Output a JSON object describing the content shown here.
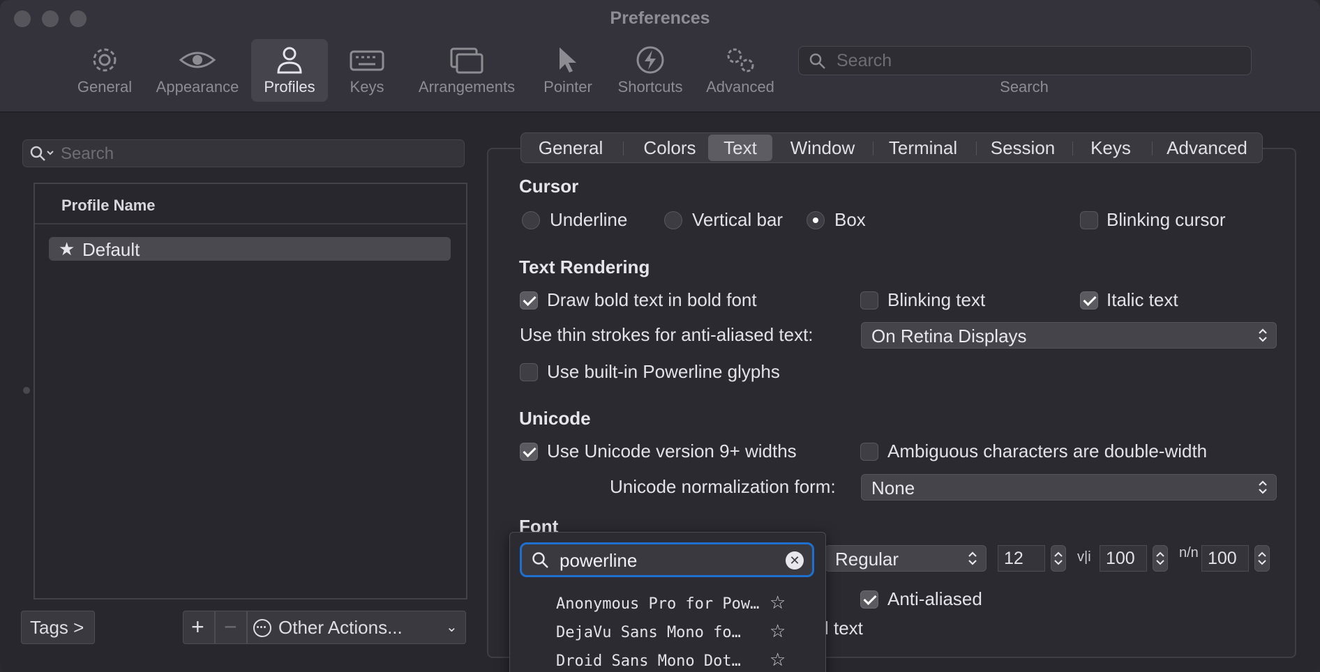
{
  "window": {
    "title": "Preferences"
  },
  "toolbar": {
    "items": [
      {
        "label": "General",
        "icon": "gear-icon"
      },
      {
        "label": "Appearance",
        "icon": "eye-icon"
      },
      {
        "label": "Profiles",
        "icon": "person-icon",
        "active": true
      },
      {
        "label": "Keys",
        "icon": "keyboard-icon"
      },
      {
        "label": "Arrangements",
        "icon": "windows-icon"
      },
      {
        "label": "Pointer",
        "icon": "pointer-icon"
      },
      {
        "label": "Shortcuts",
        "icon": "lightning-icon"
      },
      {
        "label": "Advanced",
        "icon": "gears-icon"
      }
    ],
    "search_placeholder": "Search",
    "search_caption": "Search"
  },
  "sidebar": {
    "search_placeholder": "Search",
    "column_header": "Profile Name",
    "profiles": [
      {
        "name": "Default",
        "icon": "star-icon"
      }
    ],
    "tags_label": "Tags >",
    "add_label": "+",
    "remove_label": "−",
    "other_actions_label": "Other Actions...",
    "other_actions_chevron": "⌄"
  },
  "tabs": [
    "General",
    "Colors",
    "Text",
    "Window",
    "Terminal",
    "Session",
    "Keys",
    "Advanced"
  ],
  "active_tab": "Text",
  "cursor": {
    "heading": "Cursor",
    "underline": "Underline",
    "vertical_bar": "Vertical bar",
    "box": "Box",
    "selected": "Box",
    "blinking_cursor": "Blinking cursor",
    "blinking_cursor_checked": false
  },
  "text_rendering": {
    "heading": "Text Rendering",
    "bold_label": "Draw bold text in bold font",
    "bold_checked": true,
    "blinking_text_label": "Blinking text",
    "blinking_text_checked": false,
    "italic_label": "Italic text",
    "italic_checked": true,
    "thin_strokes_label": "Use thin strokes for anti-aliased text:",
    "thin_strokes_value": "On Retina Displays",
    "powerline_label": "Use built-in Powerline glyphs",
    "powerline_checked": false
  },
  "unicode": {
    "heading": "Unicode",
    "widths_label": "Use Unicode version 9+ widths",
    "widths_checked": true,
    "ambiguous_label": "Ambiguous characters are double-width",
    "ambiguous_checked": false,
    "normalization_label": "Unicode normalization form:",
    "normalization_value": "None"
  },
  "font": {
    "heading": "Font",
    "search_value": "powerline",
    "weight": "Regular",
    "size": "12",
    "h_spacing_icon": "v|i",
    "h_spacing": "100",
    "v_spacing_icon": "n/n",
    "v_spacing": "100",
    "anti_aliased_label": "Anti-aliased",
    "anti_aliased_checked": true,
    "partial_label": "l text",
    "results": [
      {
        "name": "Anonymous Pro for Pow…"
      },
      {
        "name": "DejaVu Sans Mono fo…"
      },
      {
        "name": "Droid Sans Mono Dot…"
      }
    ]
  },
  "colors": {
    "accent_blue": "#1f6fcf",
    "window_bg": "#28272e",
    "toolbar_bg": "#34333b"
  }
}
